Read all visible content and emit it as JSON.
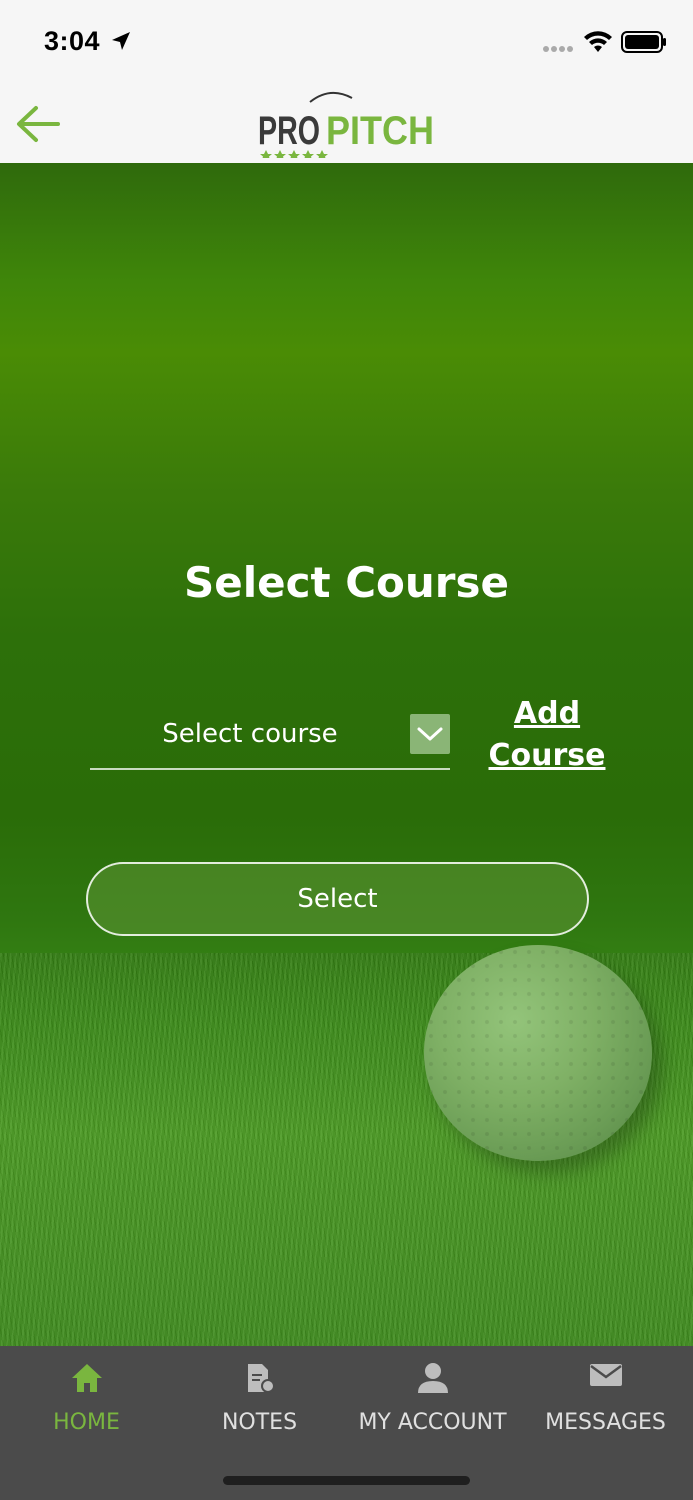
{
  "status_bar": {
    "time": "3:04"
  },
  "nav": {
    "logo_text_pro": "PRO",
    "logo_text_pitch": "PITCH",
    "back_icon": "arrow-left-icon"
  },
  "main": {
    "title": "Select Course",
    "course_select": {
      "placeholder": "Select course",
      "dropdown_icon": "chevron-down-icon"
    },
    "add_course_line1": "Add",
    "add_course_line2": "Course",
    "select_button": "Select"
  },
  "tabs": [
    {
      "label": "HOME",
      "icon": "home-icon",
      "active": true
    },
    {
      "label": "NOTES",
      "icon": "notes-icon",
      "active": false
    },
    {
      "label": "MY ACCOUNT",
      "icon": "user-icon",
      "active": false
    },
    {
      "label": "MESSAGES",
      "icon": "mail-icon",
      "active": false
    }
  ],
  "colors": {
    "accent": "#7ab63f",
    "tab_bar": "#4b4b4b",
    "text_light": "#ffffff"
  }
}
